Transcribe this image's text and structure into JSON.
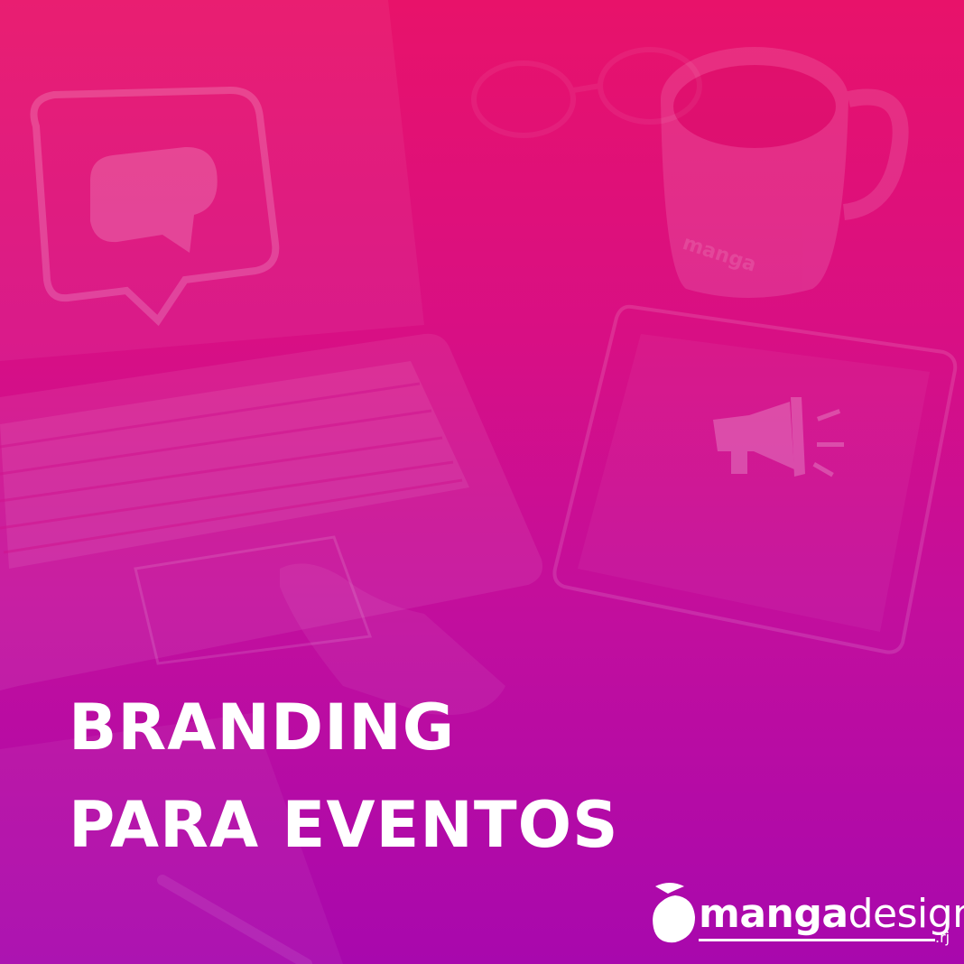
{
  "headline": {
    "line1": "BRANDING",
    "line2": "PARA EVENTOS"
  },
  "logo": {
    "name_bold": "manga",
    "name_light": "design",
    "suffix": ".rj"
  },
  "mug_print": "manga",
  "colors": {
    "gradient_top": "#e8126a",
    "gradient_bottom": "#a808ad",
    "text": "#ffffff"
  },
  "icons": [
    "chat-bubble-icon",
    "megaphone-icon",
    "mango-logo-icon"
  ]
}
